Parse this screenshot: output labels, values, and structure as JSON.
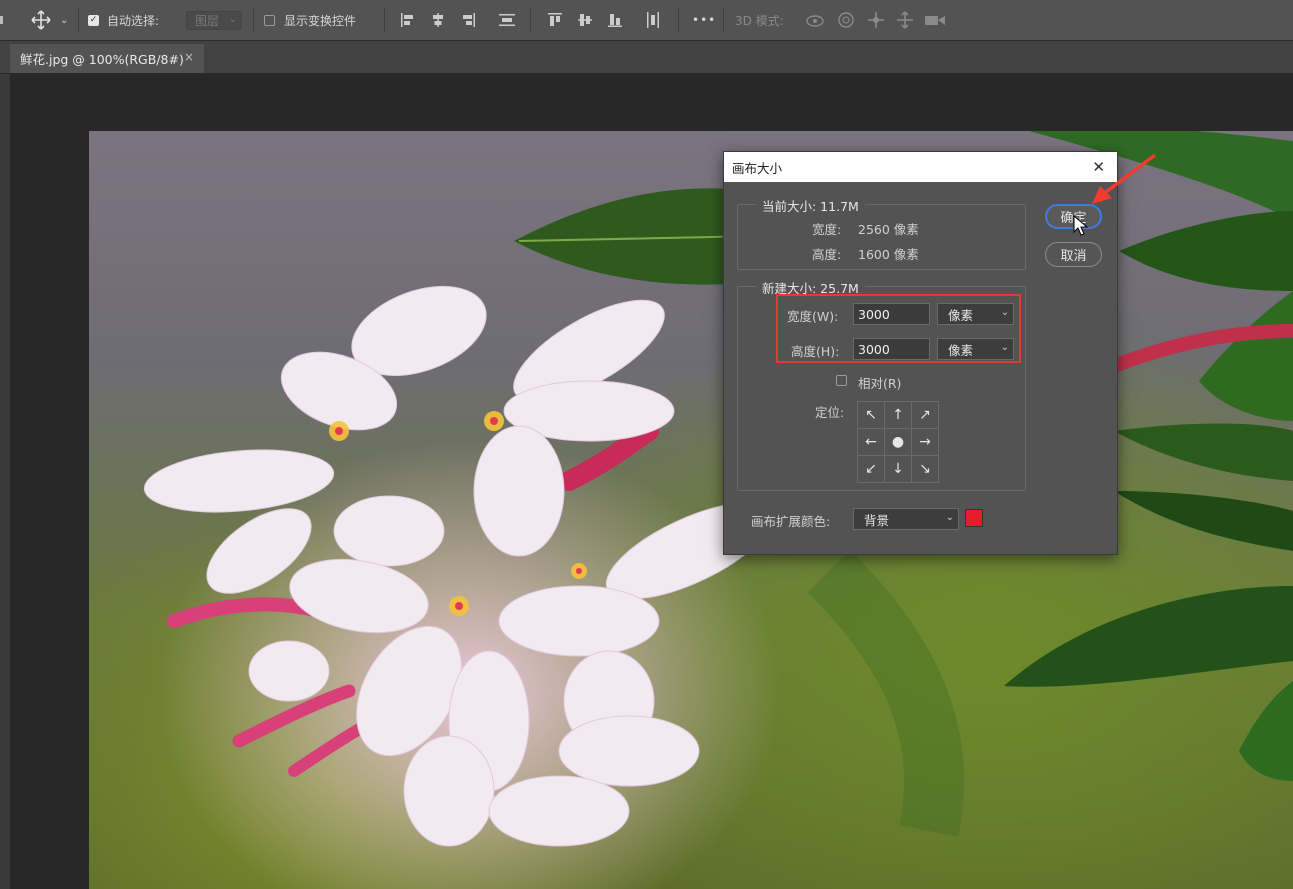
{
  "options_bar": {
    "auto_select_label": "自动选择:",
    "auto_select_value": "图层",
    "show_transform_label": "显示变换控件",
    "more_label": "•••",
    "mode_3d_label": "3D 模式:"
  },
  "document_tab": {
    "title": "鲜花.jpg @ 100%(RGB/8#)",
    "close": "×"
  },
  "dialog": {
    "title": "画布大小",
    "close": "✕",
    "current_size": {
      "title": "当前大小: 11.7M",
      "width_label": "宽度:",
      "width_value": "2560 像素",
      "height_label": "高度:",
      "height_value": "1600 像素"
    },
    "new_size": {
      "title": "新建大小: 25.7M",
      "width_label": "宽度(W):",
      "width_value": "3000",
      "width_unit": "像素",
      "height_label": "高度(H):",
      "height_value": "3000",
      "height_unit": "像素",
      "relative_label": "相对(R)",
      "anchor_label": "定位:"
    },
    "extension_color_label": "画布扩展颜色:",
    "extension_color_value": "背景",
    "extension_color_swatch": "#e51c2c",
    "ok_label": "确定",
    "cancel_label": "取消"
  },
  "icons": {
    "move": "move-icon",
    "align": "align-icon",
    "3d": "3d-mode-icon"
  }
}
